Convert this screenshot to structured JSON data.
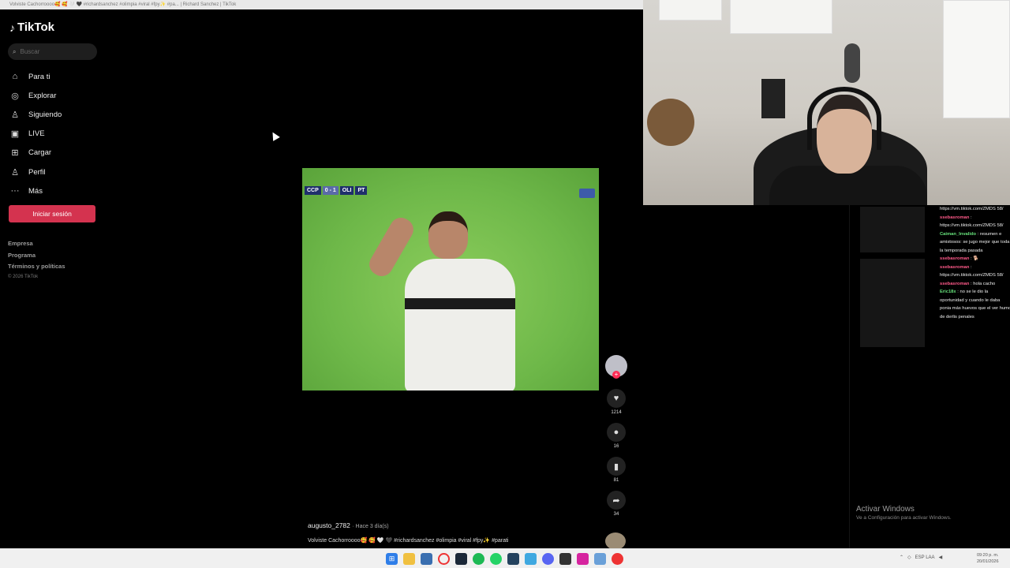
{
  "window": {
    "title": "Volviste Cachorroooo🥰 🥰 🤍 🖤 #richardsanchez #olimpia #viral #fpy✨ #pa... | Richard Sanchez | TikTok"
  },
  "tiktok": {
    "logo": "TikTok",
    "search_placeholder": "Buscar",
    "nav": [
      {
        "label": "Para ti",
        "icon": "home-icon"
      },
      {
        "label": "Explorar",
        "icon": "compass-icon"
      },
      {
        "label": "Siguiendo",
        "icon": "following-icon"
      },
      {
        "label": "LIVE",
        "icon": "live-icon"
      },
      {
        "label": "Cargar",
        "icon": "upload-icon"
      },
      {
        "label": "Perfil",
        "icon": "profile-icon"
      },
      {
        "label": "Más",
        "icon": "more-icon"
      }
    ],
    "login_label": "Iniciar sesión",
    "footer": [
      "Empresa",
      "Programa",
      "Términos y políticas"
    ],
    "copyright": "© 2026 TikTok"
  },
  "video": {
    "scoreboard": {
      "home": "CCP",
      "score": "0 - 1",
      "away": "OLI",
      "period": "PT"
    },
    "author": "augusto_2782",
    "posted": "· Hace 3 día(s)",
    "description": "Volviste Cachorroooo🥰 🥰 🤍 🖤 #richardsanchez #olimpia #viral #fpy✨ #parati",
    "progress_fraction": 0.34
  },
  "actions": {
    "likes": "1214",
    "comments": "16",
    "saves": "81",
    "shares": "34"
  },
  "chat": [
    {
      "user": "",
      "text": "https://vm.tiktok.com/ZMDS 58/"
    },
    {
      "user": "ssebasroman",
      "text": "https://vm.tiktok.com/ZMDS 58/"
    },
    {
      "user": "Caiman_Invalido",
      "text": "resumen e amistosos: se jugo mejor que toda la temporada pasada"
    },
    {
      "user": "ssebasroman",
      "text": "🐕"
    },
    {
      "user": "ssebasroman",
      "text": "https://vm.tiktok.com/ZMDS 58/"
    },
    {
      "user": "ssebasroman",
      "text": "hola cacho"
    },
    {
      "user": "Eric18x",
      "text": "no se le dio la oportunidad y cuando le daba ponia más huevos que el ver humo de derlis penales"
    }
  ],
  "windows_notice": {
    "title": "Activar Windows",
    "subtitle": "Ve a Configuración para activar Windows."
  },
  "taskbar": {
    "apps": [
      "windows-start-icon",
      "file-explorer-icon",
      "calculator-icon",
      "opera-icon",
      "steam-icon",
      "spotify-icon",
      "whatsapp-icon",
      "app-icon",
      "app-icon",
      "discord-icon",
      "app-icon",
      "instagram-icon",
      "app-icon",
      "app-icon"
    ],
    "language": "ESP LAA",
    "time": "09:20 p. m.",
    "date": "20/01/2026"
  }
}
